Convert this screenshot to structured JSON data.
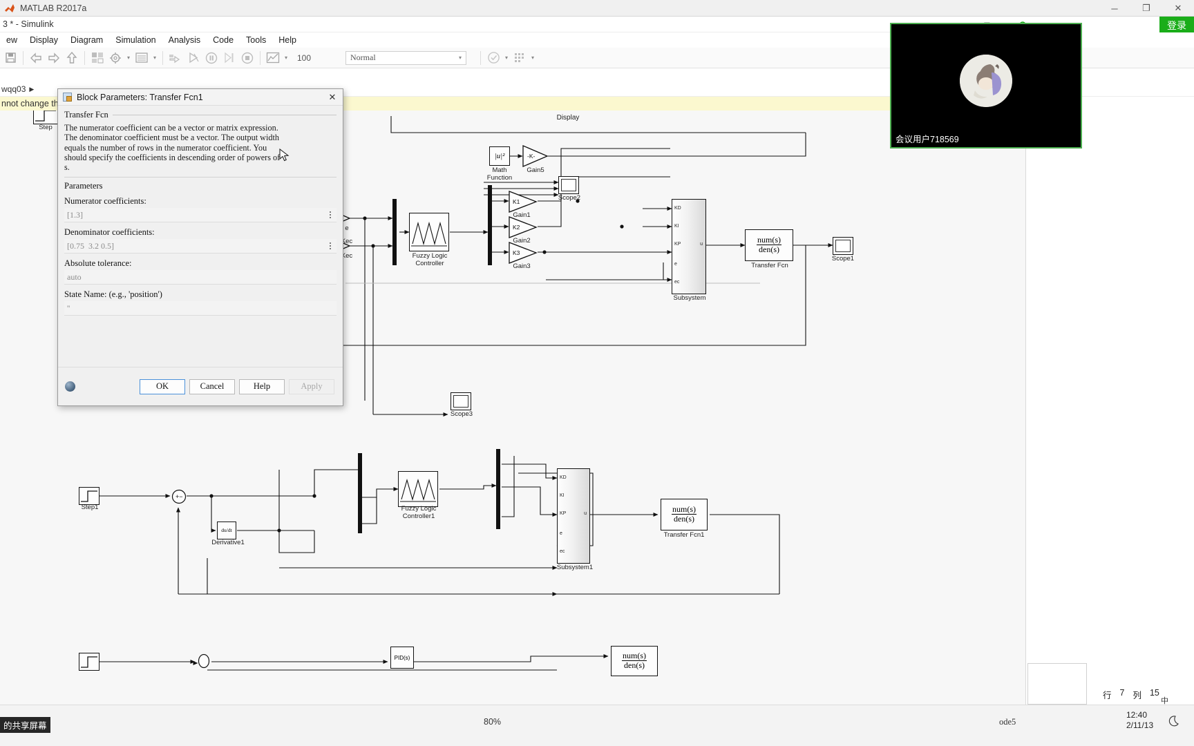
{
  "matlab": {
    "title": "MATLAB R2017a",
    "window_buttons": [
      "minimize",
      "maximize",
      "close"
    ],
    "minimize_glyph": "─",
    "maximize_glyph": "❐",
    "close_glyph": "✕"
  },
  "simulink": {
    "title": "3 * - Simulink",
    "menus": [
      "ew",
      "Display",
      "Diagram",
      "Simulation",
      "Analysis",
      "Code",
      "Tools",
      "Help"
    ],
    "toolbar": {
      "zoom_level": "100",
      "sim_mode": "Normal",
      "caret_glyph": "▾"
    },
    "breadcrumb": {
      "path": "wqq03",
      "arrow": "▶"
    },
    "warning": "nnot change the"
  },
  "dialog": {
    "title": "Block Parameters: Transfer Fcn1",
    "close_glyph": "✕",
    "section_title": "Transfer Fcn",
    "description": "The numerator coefficient can be a vector or matrix expression.\nThe denominator coefficient must be a vector. The output width\nequals the number of rows in the numerator coefficient. You\nshould specify the coefficients in descending order of powers of\ns.",
    "parameters_heading": "Parameters",
    "fields": [
      {
        "label": "Numerator coefficients:",
        "value": "[1.3]"
      },
      {
        "label": "Denominator coefficients:",
        "value": "[0.75  3.2 0.5]"
      },
      {
        "label": "Absolute tolerance:",
        "value": "auto"
      },
      {
        "label": "State Name: (e.g., 'position')",
        "value": "''"
      }
    ],
    "buttons": {
      "ok": "OK",
      "cancel": "Cancel",
      "help": "Help",
      "apply": "Apply"
    }
  },
  "cam": {
    "user_name": "会议用户718569",
    "border_color": "#4caf50"
  },
  "browser": {
    "login_label": "登录",
    "accent": "#1aad19",
    "restore_glyph": "❐",
    "chevron_glyph": "∨"
  },
  "status": {
    "share_label": "的共享屏幕",
    "zoom_percent": "80%",
    "solver": "ode5",
    "row_label": "行",
    "row_value": "7",
    "col_label": "列",
    "col_value": "15",
    "time": "12:40",
    "date": "2/11/13",
    "lang": "中"
  },
  "diagram": {
    "blocks": [
      {
        "name": "Step",
        "label": "Step"
      },
      {
        "name": "Display",
        "label": "Display"
      },
      {
        "name": "MathFunction",
        "label": "Math\nFunction",
        "glyph": "|u|²"
      },
      {
        "name": "Gain5",
        "label": "Gain5",
        "gain": "-K-"
      },
      {
        "name": "Scope2",
        "label": "Scope2"
      },
      {
        "name": "Gain1",
        "label": "Gain1",
        "gain": "K1"
      },
      {
        "name": "Gain2",
        "label": "Gain2",
        "gain": "K2"
      },
      {
        "name": "Gain3",
        "label": "Gain3",
        "gain": "K3"
      },
      {
        "name": "FuzzyLogicController",
        "label": "Fuzzy Logic\nController"
      },
      {
        "name": "Subsystem",
        "label": "Subsystem",
        "ports": [
          "KD",
          "KI",
          "KP",
          "e",
          "ec"
        ],
        "out": "u"
      },
      {
        "name": "TransferFcn",
        "label": "Transfer Fcn",
        "num": "num(s)",
        "den": "den(s)"
      },
      {
        "name": "Scope1",
        "label": "Scope1"
      },
      {
        "name": "Scope3",
        "label": "Scope3"
      },
      {
        "name": "Step1",
        "label": "Step1"
      },
      {
        "name": "Derivative1",
        "label": "Derivative1",
        "glyph": "du/dt"
      },
      {
        "name": "FuzzyLogicController1",
        "label": "Fuzzy Logic\nController1"
      },
      {
        "name": "Subsystem1",
        "label": "Subsystem1",
        "ports": [
          "KD",
          "KI",
          "KP",
          "e",
          "ec"
        ],
        "out": "u"
      },
      {
        "name": "TransferFcn1",
        "label": "Transfer Fcn1",
        "num": "num(s)",
        "den": "den(s)"
      },
      {
        "name": "PID",
        "label": "",
        "glyph": "PID(s)"
      },
      {
        "name": "TransferFcn2",
        "label": "",
        "num": "num(s)",
        "den": "den(s)"
      }
    ],
    "signal_labels": [
      "e",
      "Kec",
      "Kec"
    ]
  }
}
